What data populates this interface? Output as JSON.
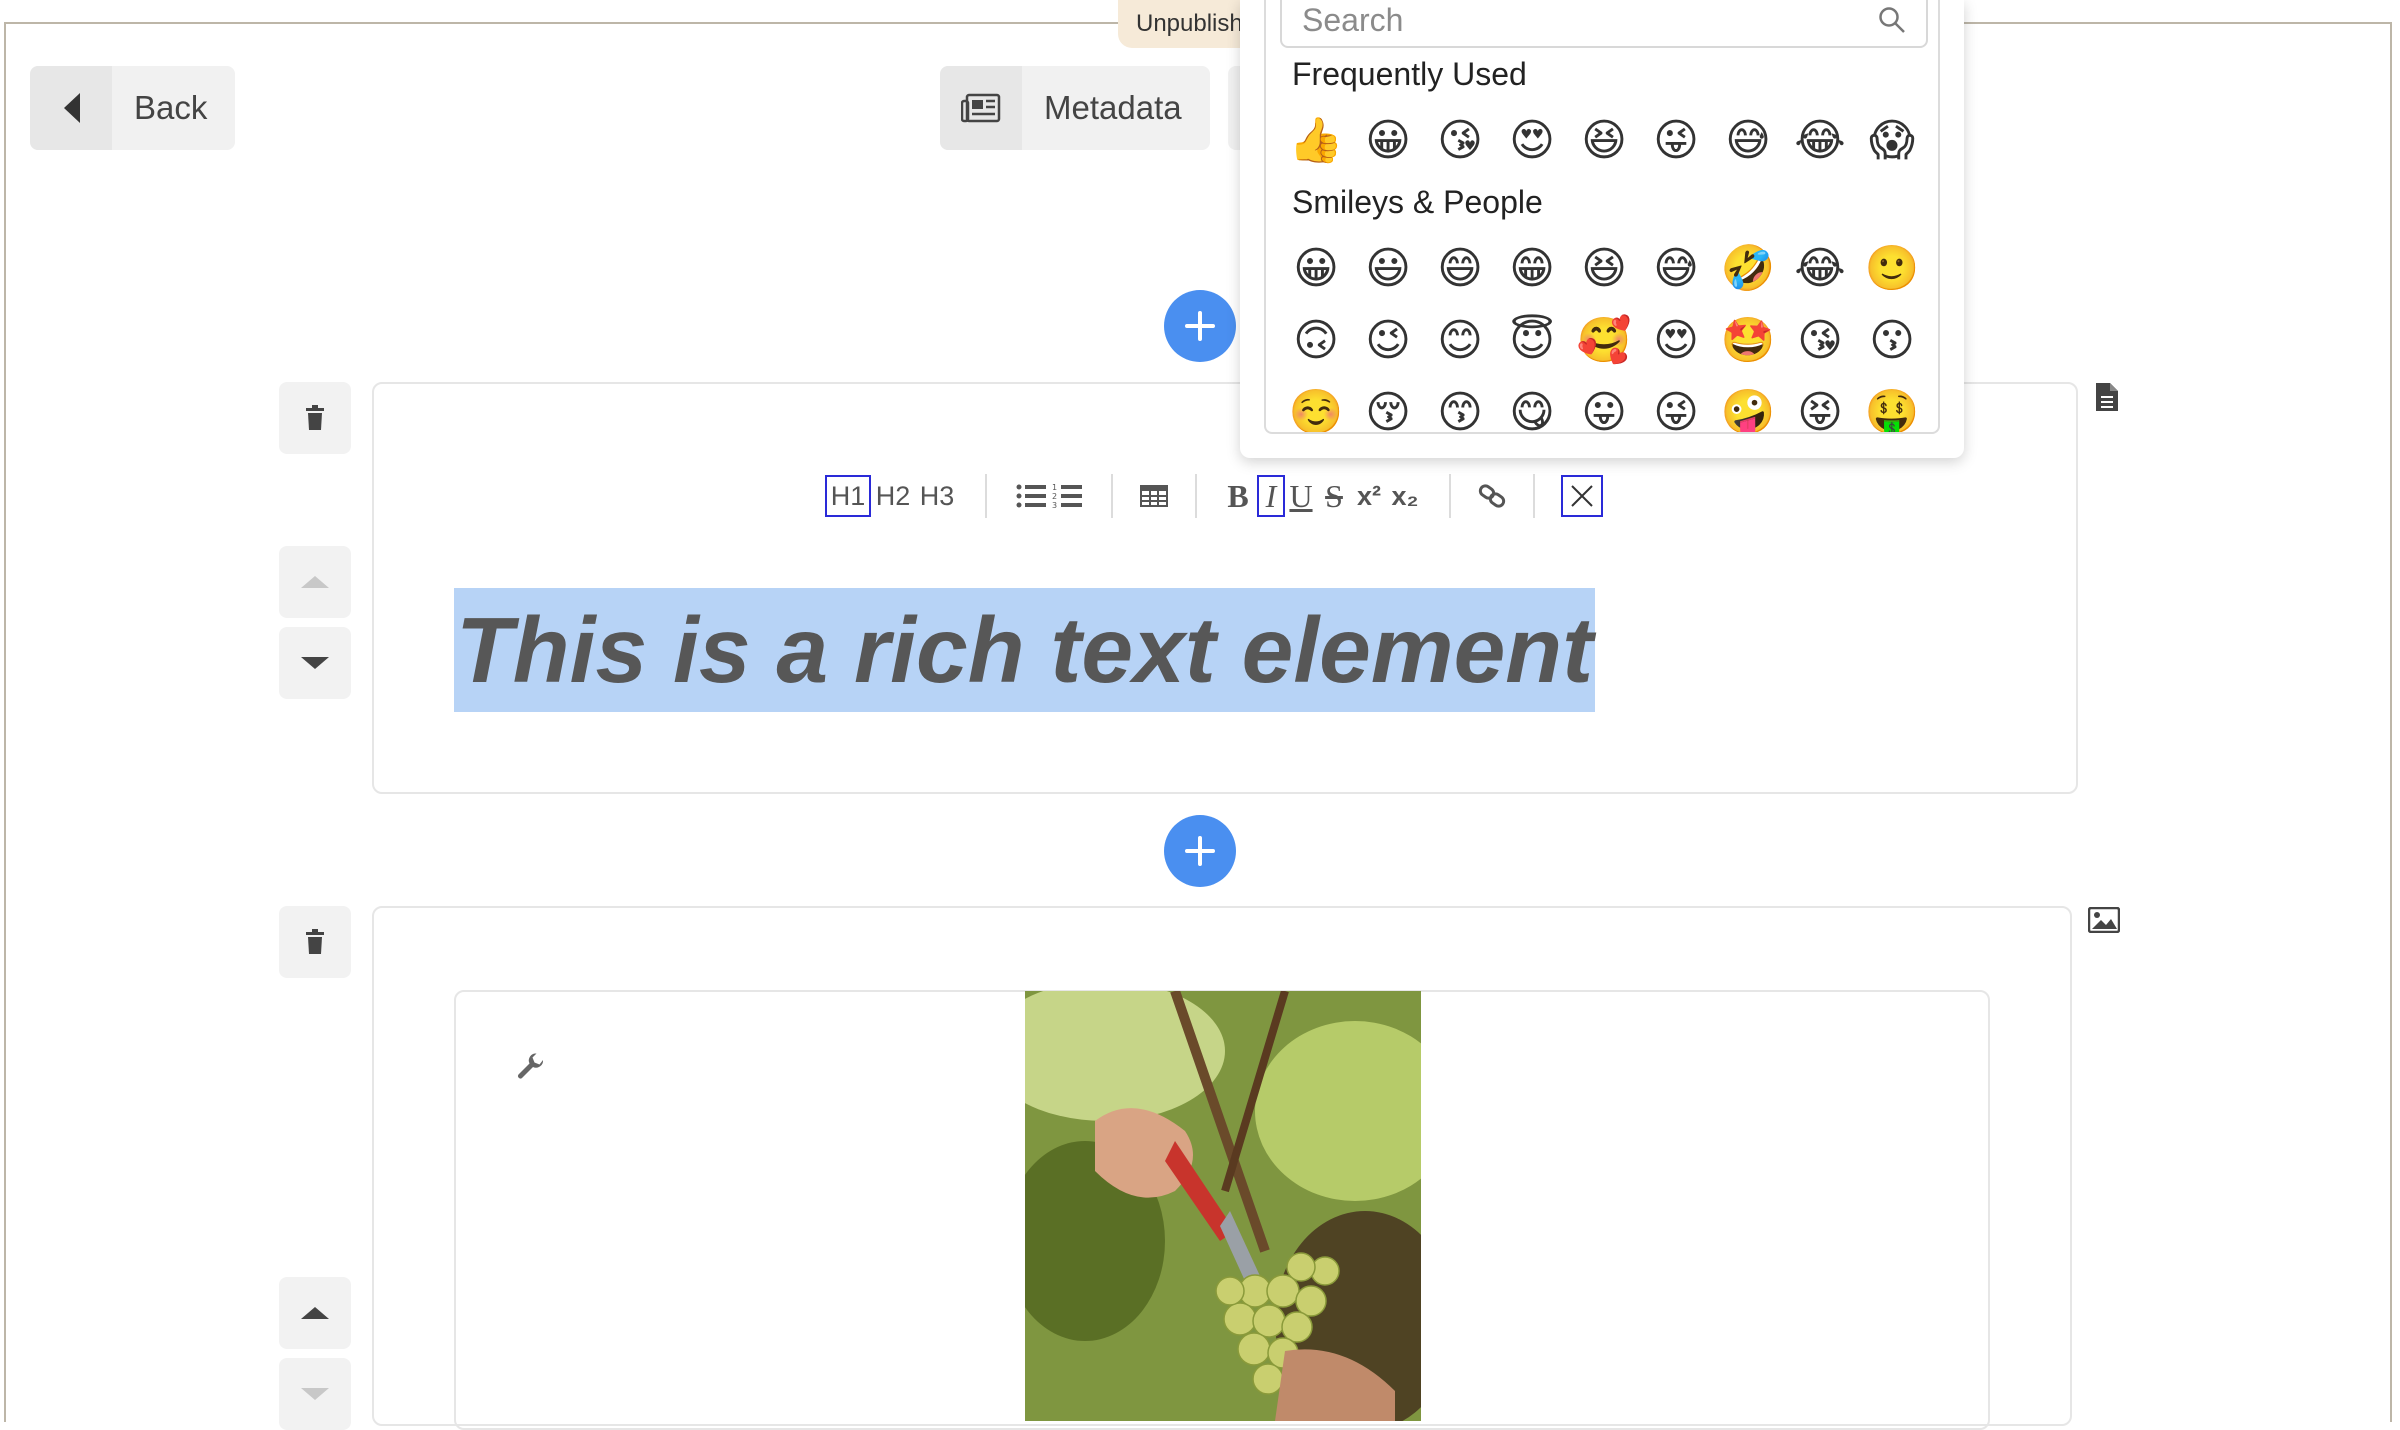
{
  "app": {
    "status_pill": "Unpublish"
  },
  "header": {
    "back_label": "Back",
    "metadata_label": "Metadata"
  },
  "rich_text": {
    "content": "This is a rich text element"
  },
  "toolbar": {
    "h1": "H1",
    "h2": "H2",
    "h3": "H3",
    "bold": "B",
    "italic": "I",
    "underline": "U",
    "strike": "S",
    "superscript": "x²",
    "subscript": "x₂"
  },
  "emoji_picker": {
    "search_placeholder": "Search",
    "frequently_used_title": "Frequently Used",
    "frequently_used": [
      "👍",
      "😀",
      "😘",
      "😍",
      "😆",
      "😜",
      "😅",
      "😂",
      "😱"
    ],
    "smileys_title": "Smileys & People",
    "smileys_rows": [
      [
        "😀",
        "😃",
        "😄",
        "😁",
        "😆",
        "😅",
        "🤣",
        "😂",
        "🙂"
      ],
      [
        "🙃",
        "😉",
        "😊",
        "😇",
        "🥰",
        "😍",
        "🤩",
        "😘",
        "😗"
      ],
      [
        "☺️",
        "😚",
        "😙",
        "😋",
        "😛",
        "😜",
        "🤪",
        "😝",
        "🤑"
      ]
    ]
  },
  "colors": {
    "accent": "#4a8ff0",
    "selection": "#b7d3f6",
    "status_pill_bg": "#f6ead8",
    "focus_outline": "#2a2ad8"
  }
}
